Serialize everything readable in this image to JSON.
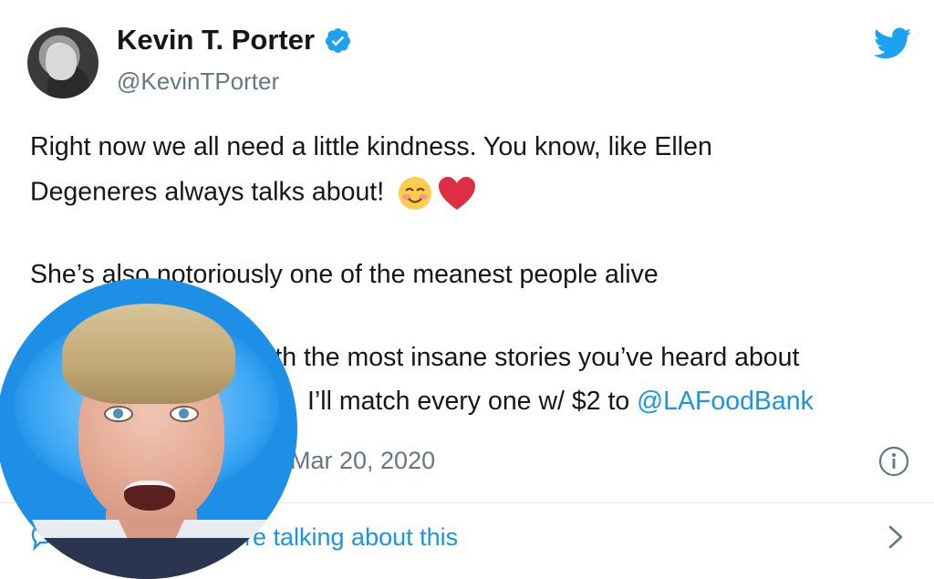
{
  "author": {
    "display_name": "Kevin T. Porter",
    "handle": "@KevinTPorter",
    "verified": true
  },
  "tweet": {
    "line1": "Right now we all need a little kindness. You know, like Ellen",
    "line2": "Degeneres always talks about!",
    "line3": "She’s also notoriously one of the meanest people alive",
    "line4_visible": "ith the most insane stories you’ve heard about",
    "line5_visible": "I’ll match every one w/ $2 to ",
    "line5_mention": "@LAFoodBank",
    "emojis": [
      "smiling-face-with-smiling-eyes-emoji",
      "red-heart-emoji"
    ]
  },
  "meta": {
    "timestamp_visible": "Mar 20, 2020"
  },
  "footer": {
    "label_visible": "re talking about this"
  },
  "icons": {
    "brand": "twitter-bird-icon",
    "verified": "verified-badge-icon",
    "info": "info-icon",
    "reply": "reply-icon",
    "chevron": "chevron-right-icon"
  },
  "colors": {
    "twitter_blue": "#1b95e0",
    "text_primary": "#14171a",
    "text_secondary": "#657786",
    "divider": "#e1e8ed",
    "overlay_bg": "#1e8fe6"
  }
}
